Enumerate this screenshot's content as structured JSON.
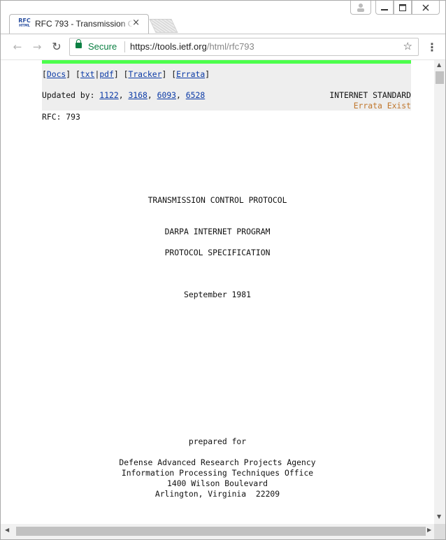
{
  "browser": {
    "tab": {
      "favicon_top": "RFC",
      "favicon_bottom": "HTML",
      "title": "RFC 793 - Transmission C",
      "close_glyph": "×"
    },
    "window_controls": {
      "user": "user-icon",
      "minimize": "minimize-icon",
      "maximize": "maximize-icon",
      "close": "close-icon"
    },
    "toolbar": {
      "back": "←",
      "forward": "→",
      "reload": "↻",
      "secure_label": "Secure",
      "url_host": "https://tools.ietf.org",
      "url_path": "/html/rfc793",
      "star": "☆",
      "menu": "⋮"
    }
  },
  "colors": {
    "accent_bar": "#4cff4c",
    "header_bg": "#eeeeee",
    "link": "#0b3aa6",
    "errata": "#c0762b",
    "secure": "#0b8043"
  },
  "document": {
    "nav_links": {
      "docs": "Docs",
      "txt": "txt",
      "pdf": "pdf",
      "tracker": "Tracker",
      "errata": "Errata"
    },
    "updated_by_label": "Updated by: ",
    "updated_by": [
      "1122",
      "3168",
      "6093",
      "6528"
    ],
    "status": "INTERNET STANDARD",
    "errata_exist": "Errata Exist",
    "rfc_number": "RFC: 793",
    "title": "TRANSMISSION CONTROL PROTOCOL",
    "program": "DARPA INTERNET PROGRAM",
    "spec": "PROTOCOL SPECIFICATION",
    "date": "September 1981",
    "prepared_for": "prepared for",
    "agency": "Defense Advanced Research Projects Agency",
    "office": "Information Processing Techniques Office",
    "street": "1400 Wilson Boulevard",
    "city": "Arlington, Virginia  22209"
  }
}
